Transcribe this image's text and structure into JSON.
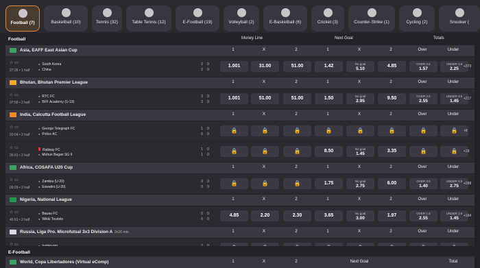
{
  "tabs": [
    {
      "label": "Football (7)",
      "icon": "soccer-ball-icon",
      "active": true
    },
    {
      "label": "Basketball (10)",
      "icon": "basketball-icon"
    },
    {
      "label": "Tennis (32)",
      "icon": "tennis-ball-icon"
    },
    {
      "label": "Table Tennis (12)",
      "icon": "table-tennis-icon"
    },
    {
      "label": "E-Football (19)",
      "icon": "e-football-icon"
    },
    {
      "label": "Volleyball (2)",
      "icon": "volleyball-icon"
    },
    {
      "label": "E-Basketball (6)",
      "icon": "e-basketball-icon"
    },
    {
      "label": "Cricket (3)",
      "icon": "cricket-bat-icon"
    },
    {
      "label": "Counter-Strike (1)",
      "icon": "counter-strike-icon"
    },
    {
      "label": "Cycling (2)",
      "icon": "cycling-icon"
    },
    {
      "label": "Snooker (",
      "icon": "snooker-icon"
    }
  ],
  "section_title": "Football",
  "market_headers": {
    "money_line": "Money Line",
    "next_goal": "Next Goal",
    "totals": "Totals"
  },
  "col_labels": [
    "1",
    "X",
    "2",
    "1",
    "X",
    "2",
    "Over",
    "Under"
  ],
  "lock_glyph": "🔒",
  "leagues": [
    {
      "name": "Asia, EAFF East Asian Cup",
      "flag_color": "#3aa35c",
      "matches": [
        {
          "time": "27:26 • 1 half",
          "teams": [
            "South Korea",
            "China"
          ],
          "scores": [
            [
              "2",
              "0"
            ],
            [
              "2",
              "0"
            ]
          ],
          "odds": [
            {
              "v": "1.001"
            },
            {
              "v": "31.00"
            },
            {
              "v": "51.00"
            },
            {
              "v": "1.42"
            },
            {
              "s": "No goal",
              "v": "5.10"
            },
            {
              "v": "4.85"
            },
            {
              "s": "OVER 3.5",
              "v": "1.57"
            },
            {
              "s": "UNDER 3.5",
              "v": "2.25"
            }
          ],
          "more": "+373"
        }
      ]
    },
    {
      "name": "Bhutan, Bhutan Premier League",
      "flag_color": "#f0a830",
      "matches": [
        {
          "time": "07:58 • 2 half",
          "teams": [
            "RTC FC",
            "BFF Academy (U-19)"
          ],
          "scores": [
            [
              "3",
              "0"
            ],
            [
              "3",
              "0"
            ]
          ],
          "odds": [
            {
              "v": "1.001"
            },
            {
              "v": "51.00"
            },
            {
              "v": "51.00"
            },
            {
              "v": "1.50"
            },
            {
              "s": "No goal",
              "v": "2.95"
            },
            {
              "v": "9.50"
            },
            {
              "s": "OVER 3.5",
              "v": "2.55"
            },
            {
              "s": "UNDER 3.5",
              "v": "1.45"
            }
          ],
          "more": "+217"
        }
      ]
    },
    {
      "name": "India, Calcutta Football League",
      "flag_color": "#f08a24",
      "matches": [
        {
          "time": "03:04 • 2 half",
          "teams": [
            "George Telegraph FC",
            "Police AC"
          ],
          "scores": [
            [
              "1",
              "0"
            ],
            [
              "0",
              "0"
            ]
          ],
          "odds": [
            {
              "lock": true
            },
            {
              "lock": true
            },
            {
              "lock": true
            },
            {
              "lock": true
            },
            {
              "lock": true
            },
            {
              "lock": true
            },
            {
              "lock": true
            },
            {
              "lock": true
            }
          ],
          "more": "+8"
        },
        {
          "time": "05:01 • 2 half",
          "teams": [
            "Railway FC",
            "Mohun Bagan SG II"
          ],
          "card": true,
          "scores": [
            [
              "1",
              "0"
            ],
            [
              "1",
              "0"
            ]
          ],
          "odds": [
            {
              "lock": true
            },
            {
              "lock": true
            },
            {
              "lock": true
            },
            {
              "v": "8.50"
            },
            {
              "s": "No goal",
              "v": "1.45"
            },
            {
              "v": "3.35"
            },
            {
              "lock": true
            },
            {
              "lock": true
            }
          ],
          "more": "+18"
        }
      ]
    },
    {
      "name": "Africa, COSAFA U20 Cup",
      "flag_color": "#3aa35c",
      "matches": [
        {
          "time": "09:29 • 2 half",
          "teams": [
            "Zambia (U-20)",
            "Eswatini (U-20)"
          ],
          "scores": [
            [
              "3",
              "0"
            ],
            [
              "0",
              "0"
            ]
          ],
          "odds": [
            {
              "lock": true
            },
            {
              "lock": true
            },
            {
              "lock": true
            },
            {
              "v": "1.75"
            },
            {
              "s": "No goal",
              "v": "2.75"
            },
            {
              "v": "6.00"
            },
            {
              "s": "OVER 3.5",
              "v": "1.40"
            },
            {
              "s": "UNDER 3.5",
              "v": "2.75"
            }
          ],
          "more": "+288"
        }
      ]
    },
    {
      "name": "Nigeria, National League",
      "flag_color": "#1e9a4a",
      "matches": [
        {
          "time": "45:01 • 2 half",
          "teams": [
            "Bauau FC",
            "Wikki Tourists"
          ],
          "scores": [
            [
              "0",
              "0"
            ],
            [
              "0",
              "0"
            ]
          ],
          "odds": [
            {
              "v": "4.85"
            },
            {
              "v": "2.20"
            },
            {
              "v": "2.30"
            },
            {
              "v": "3.65"
            },
            {
              "s": "No goal",
              "v": "3.00"
            },
            {
              "v": "1.97"
            },
            {
              "s": "OVER 1.5",
              "v": "2.55"
            },
            {
              "s": "UNDER 1.5",
              "v": "1.45"
            }
          ],
          "more": "+184"
        }
      ]
    },
    {
      "name": "Russia, Liga Pro. Microfutsal 3x3 Division A",
      "extra": "2x10 min.",
      "flag_color": "#d8dbe6",
      "matches": [
        {
          "time": "10:02 • 2 half",
          "teams": [
            "Iupiter-pro",
            "Pluton-pro"
          ],
          "scores": [
            [
              "2",
              "0"
            ],
            [
              "0",
              "0"
            ]
          ],
          "odds": [
            {
              "lock": true
            },
            {
              "lock": true
            },
            {
              "lock": true
            },
            {
              "lock": true
            },
            {
              "lock": true
            },
            {
              "lock": true
            },
            {
              "lock": true
            },
            {
              "lock": true
            }
          ],
          "more": ""
        }
      ]
    }
  ],
  "efootball_title": "E-Football",
  "efootball_league": {
    "name": "World, Copa Libertadores (Virtual eComp)",
    "flag_color": "#3aa35c",
    "cols": [
      "1",
      "X",
      "2",
      "",
      "Next Goal",
      "",
      "",
      "Total"
    ]
  }
}
